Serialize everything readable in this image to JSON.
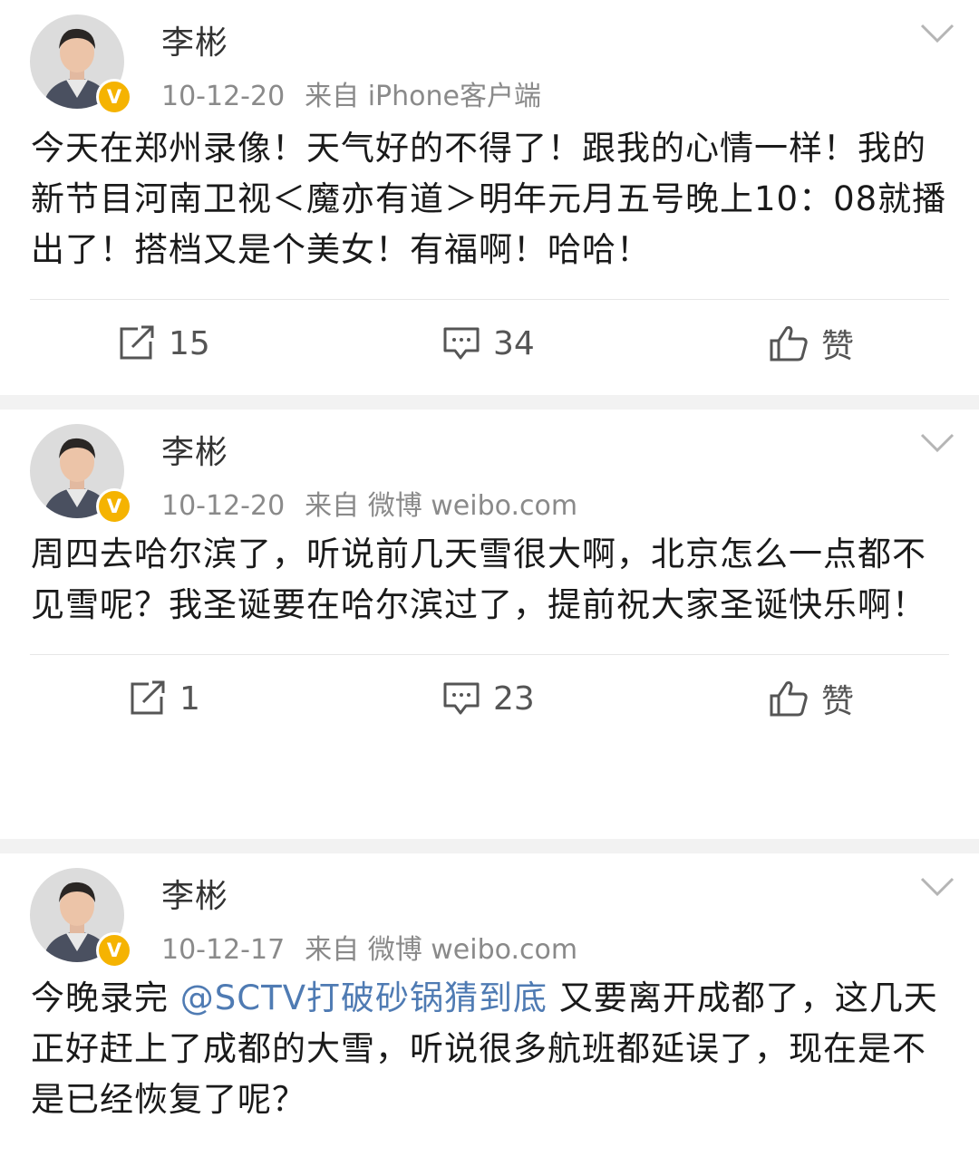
{
  "posts": [
    {
      "name": "李彬",
      "date": "10-12-20",
      "source": "来自 iPhone客户端",
      "text": "今天在郑州录像！天气好的不得了！跟我的心情一样！我的新节目河南卫视＜魔亦有道＞明年元月五号晚上10：08就播出了！搭档又是个美女！有福啊！哈哈！",
      "reposts": "15",
      "comments": "34",
      "like_label": "赞"
    },
    {
      "name": "李彬",
      "date": "10-12-20",
      "source": "来自 微博 weibo.com",
      "text": "周四去哈尔滨了，听说前几天雪很大啊，北京怎么一点都不见雪呢？我圣诞要在哈尔滨过了，提前祝大家圣诞快乐啊！",
      "reposts": "1",
      "comments": "23",
      "like_label": "赞"
    },
    {
      "name": "李彬",
      "date": "10-12-17",
      "source": "来自 微博 weibo.com",
      "text_before": "今晚录完 ",
      "mention": "@SCTV打破砂锅猜到底",
      "text_after": " 又要离开成都了，这几天正好赶上了成都的大雪，听说很多航班都延误了，现在是不是已经恢复了呢？"
    }
  ],
  "verified_badge": "V",
  "colors": {
    "mention": "#4f7bb3",
    "badge": "#f5b301",
    "meta": "#8a8a8a"
  },
  "icons": [
    "avatar",
    "verified-badge-icon",
    "chevron-down-icon",
    "repost-icon",
    "comment-icon",
    "like-icon"
  ]
}
